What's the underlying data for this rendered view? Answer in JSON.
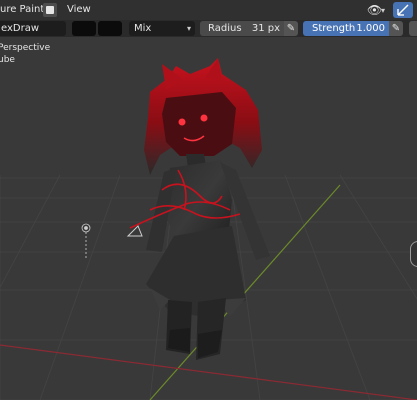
{
  "header": {
    "mode_label": "ure Paint",
    "view_menu": "View"
  },
  "tool_settings": {
    "brush_name": "exDraw",
    "blend_mode": "Mix",
    "radius_label": "Radius",
    "radius_value": "31 px",
    "strength_label": "Strength",
    "strength_value": "1.000"
  },
  "viewport": {
    "projection_text": "Perspective",
    "object_text": "ube"
  },
  "colors": {
    "background": "#393939",
    "header": "#303030",
    "accent_blue": "#4772b3",
    "paint_red": "#c8121e"
  },
  "icons": [
    "texture-paint-mode-icon",
    "eye-visibility-icon",
    "gizmo-toggle-icon",
    "pen-pressure-icon",
    "light-gizmo-icon",
    "camera-gizmo-icon"
  ]
}
